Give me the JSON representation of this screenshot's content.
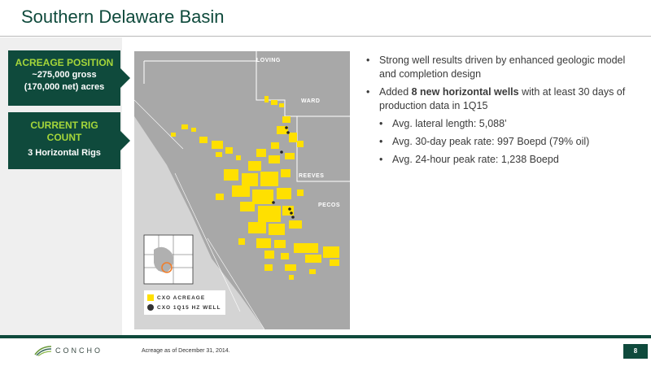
{
  "header": {
    "title": "Southern Delaware Basin"
  },
  "callouts": {
    "acreage": {
      "heading": "ACREAGE POSITION",
      "line1": "~275,000 gross",
      "line2": "(170,000 net) acres"
    },
    "rigs": {
      "heading_line1": "CURRENT RIG",
      "heading_line2": "COUNT",
      "body": "3 Horizontal Rigs"
    }
  },
  "map": {
    "counties": [
      "LOVING",
      "WARD",
      "REEVES",
      "PECOS"
    ],
    "legend": {
      "acreage": "CXO ACREAGE",
      "wells": "CXO 1Q15 HZ WELL"
    },
    "colors": {
      "acreage": "#ffe000",
      "background": "#cfcfcf",
      "basin": "#a3a3a3"
    }
  },
  "bullets": {
    "b1": "Strong well results driven by enhanced geologic model and completion design",
    "b2_pre": "Added ",
    "b2_bold": "8 new horizontal wells",
    "b2_post": " with at least 30 days of production data in 1Q15",
    "sub1": "Avg. lateral length: 5,088’",
    "sub2": "Avg. 30-day peak rate: 997 Boepd (79% oil)",
    "sub3": "Avg. 24-hour peak rate: 1,238 Boepd"
  },
  "footer": {
    "logo": "CONCHO",
    "footnote": "Acreage as of December 31, 2014.",
    "page": "8"
  },
  "colors": {
    "brand": "#0f4a3c",
    "accent": "#a5d63a"
  }
}
